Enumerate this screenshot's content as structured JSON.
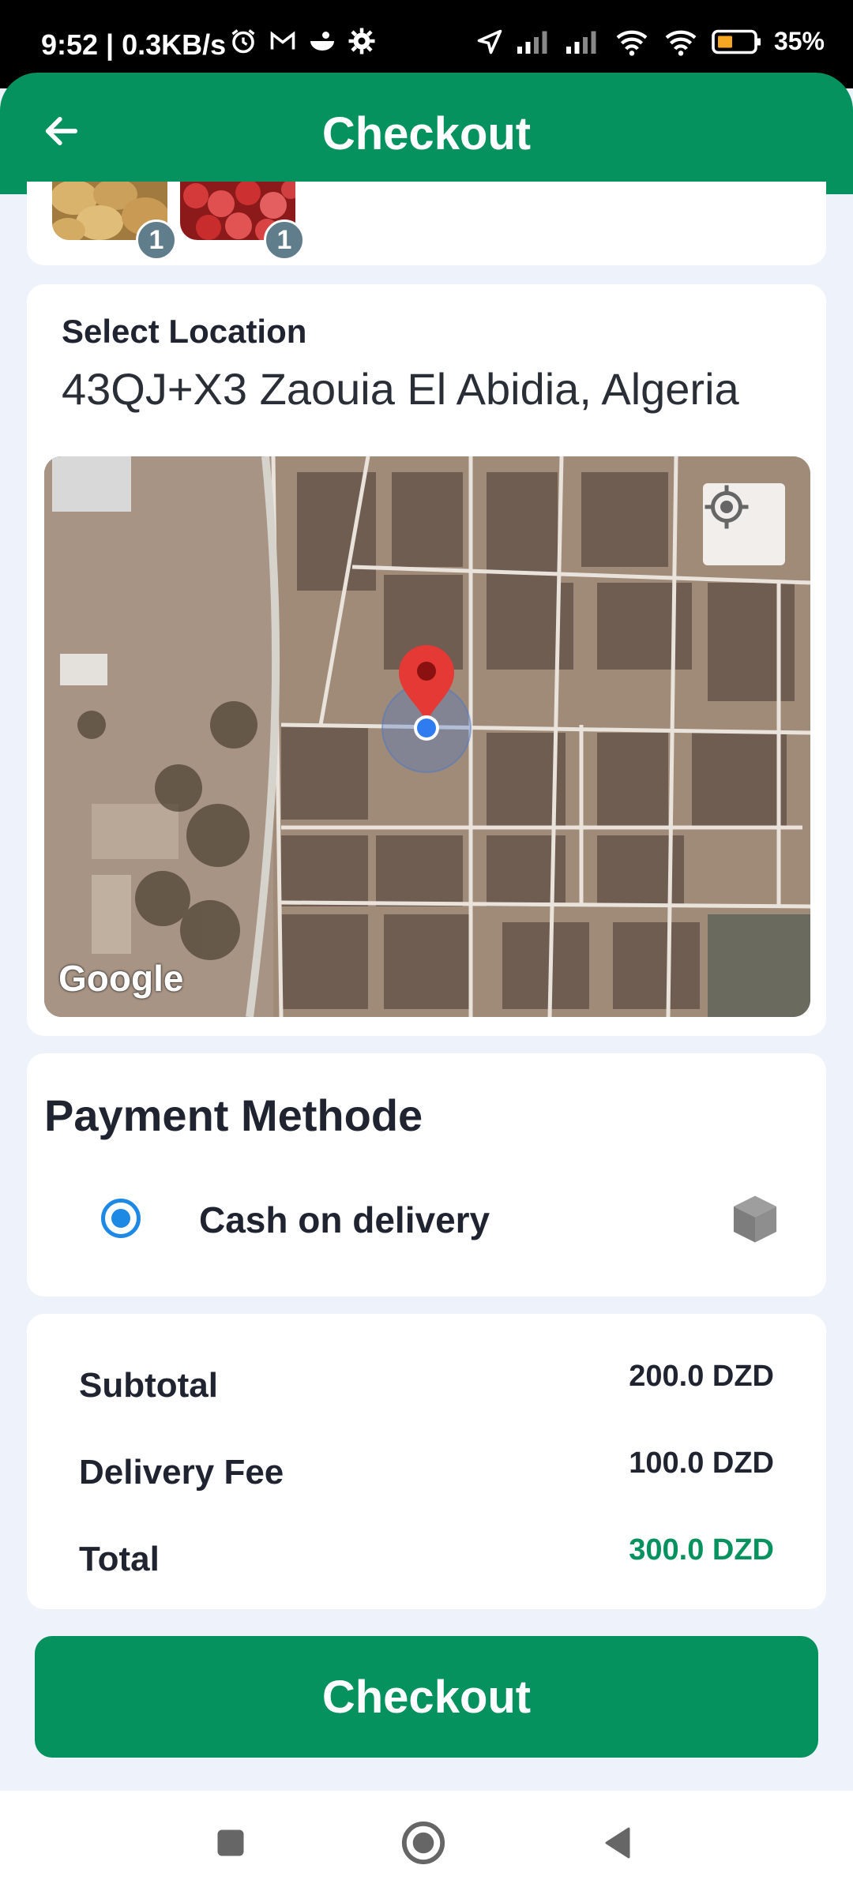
{
  "status_bar": {
    "time": "9:52 | 0.3KB/s",
    "battery": "35%"
  },
  "header": {
    "title": "Checkout"
  },
  "products": [
    {
      "name": "potatoes",
      "quantity": "1"
    },
    {
      "name": "apples",
      "quantity": "1"
    }
  ],
  "location": {
    "label": "Select Location",
    "address": "43QJ+X3 Zaouia El Abidia, Algeria",
    "map_attribution": "Google"
  },
  "payment": {
    "title": "Payment Methode",
    "option_label": "Cash on delivery",
    "selected": true
  },
  "summary": {
    "subtotal_label": "Subtotal",
    "subtotal_value": "200.0 DZD",
    "delivery_label": "Delivery Fee",
    "delivery_value": "100.0 DZD",
    "total_label": "Total",
    "total_value": "300.0 DZD"
  },
  "checkout_button": "Checkout",
  "colors": {
    "primary": "#05925e",
    "radio": "#1e88e5",
    "badge": "#607d8b",
    "background": "#eef2fa"
  }
}
